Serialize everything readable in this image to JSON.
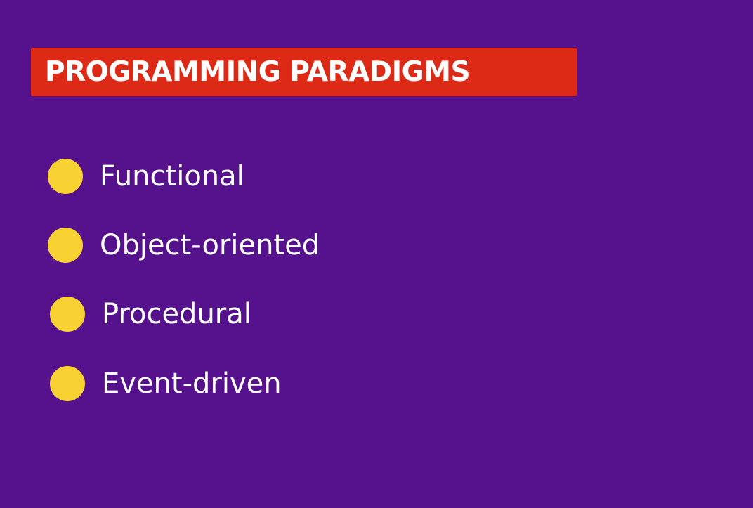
{
  "slide": {
    "title": "PROGRAMMING PARADIGMS",
    "items": [
      {
        "label": "Functional"
      },
      {
        "label": "Object-oriented"
      },
      {
        "label": "Procedural"
      },
      {
        "label": "Event-driven"
      }
    ]
  },
  "colors": {
    "background": "#56128c",
    "banner": "#dc2a16",
    "bullet": "#f8d232",
    "text": "#ffffff"
  },
  "icons": {
    "bullet": "filled-circle-icon"
  }
}
